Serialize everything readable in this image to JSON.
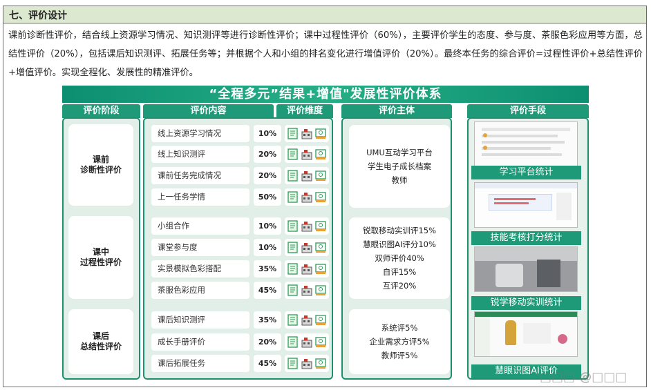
{
  "section": {
    "title": "七、评价设计"
  },
  "paragraph": "课前诊断性评价，结合线上资源学习情况、知识测评等进行诊断性评价；课中过程性评价（60%），主要评价学生的态度、参与度、茶服色彩应用等方面，总结性评价（20%），包括课后知识测评、拓展任务等；并根据个人和小组的排名变化进行增值评价（20%）。最终本任务的综合评价=过程性评价+总结性评价+增值评价。实现全程化、发展性的精准评价。",
  "figure": {
    "title": "“全程多元”结果+增值\"发展性评价体系",
    "headers": {
      "stage": "评价阶段",
      "content": "评价内容",
      "dimension": "评价维度",
      "subject": "评价主体",
      "means": "评价手段"
    },
    "stages": [
      {
        "name": "课前\n诊断性评价",
        "items": [
          {
            "label": "线上资源学习情况",
            "pct": "10%"
          },
          {
            "label": "线上知识测评",
            "pct": "20%"
          },
          {
            "label": "课前任务完成情况",
            "pct": "20%"
          },
          {
            "label": "上一任务学情",
            "pct": "50%"
          }
        ],
        "subject": [
          "UMU互动学习平台",
          "学生电子成长档案",
          "教师"
        ]
      },
      {
        "name": "课中\n过程性评价",
        "items": [
          {
            "label": "小组合作",
            "pct": "10%"
          },
          {
            "label": "课堂参与度",
            "pct": "10%"
          },
          {
            "label": "实景模拟色彩搭配",
            "pct": "35%"
          },
          {
            "label": "茶服色彩应用",
            "pct": "45%"
          }
        ],
        "subject": [
          "锐取移动实训评15%",
          "慧眼识图AI评分10%",
          "双师评价40%",
          "自评15%",
          "互评20%"
        ]
      },
      {
        "name": "课后\n总结性评价",
        "items": [
          {
            "label": "课后知识测评",
            "pct": "35%"
          },
          {
            "label": "成长手册评价",
            "pct": "20%"
          },
          {
            "label": "课后拓展任务",
            "pct": "45%"
          }
        ],
        "subject": [
          "系统评5%",
          "企业需求方评5%",
          "教师评5%"
        ]
      }
    ],
    "means": [
      "学习平台统计",
      "技能考核打分统计",
      "锐学移动实训统计",
      "慧眼识图AI评价"
    ]
  },
  "icon_names": [
    "document-icon",
    "building-icon",
    "certificate-icon"
  ],
  "colors": {
    "accent": "#1e9a78",
    "panel": "#e2efe8",
    "header_bg": "#dce8cf"
  }
}
